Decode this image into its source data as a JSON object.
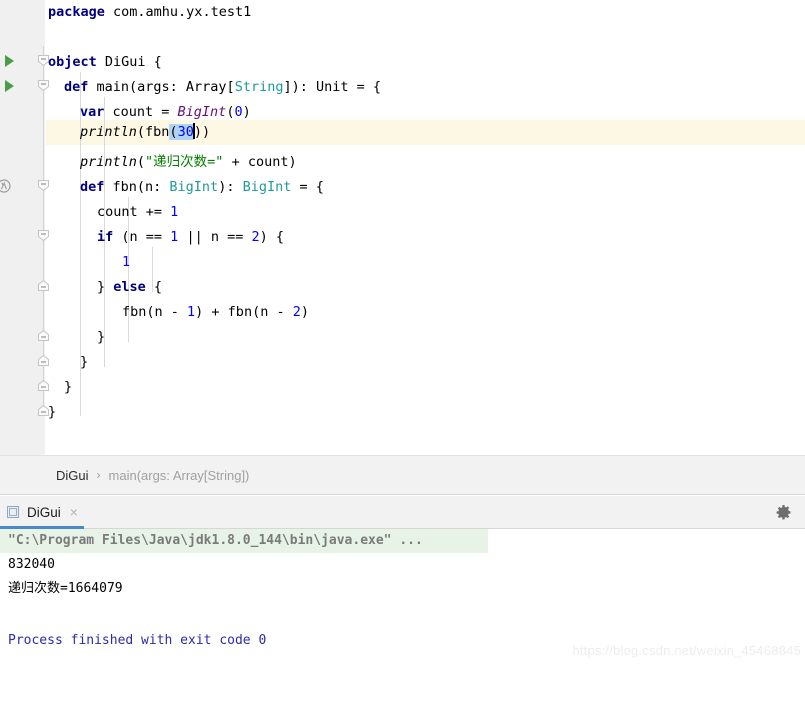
{
  "editor": {
    "name": "scala-code-editor",
    "language": "Scala",
    "current_line_number": 6,
    "colors": {
      "keyword": "#000080",
      "type": "#20999d",
      "number": "#0000ff",
      "string": "#008000",
      "class_name": "#660e7a",
      "selection": "#b0d3f5",
      "current_line": "#fdf8e3",
      "gutter": "#f0f0f0"
    },
    "lines": [
      {
        "n": 1,
        "tokens": [
          {
            "t": "package",
            "c": "kw"
          },
          {
            "t": " com.amhu.yx.test1",
            "c": "plain"
          }
        ]
      },
      {
        "n": 2,
        "tokens": []
      },
      {
        "n": 3,
        "tokens": [
          {
            "t": "object",
            "c": "kw"
          },
          {
            "t": " DiGui {",
            "c": "plain"
          }
        ]
      },
      {
        "n": 4,
        "tokens": [
          {
            "t": "def",
            "c": "kw"
          },
          {
            "t": " main(args: Array[",
            "c": "plain"
          },
          {
            "t": "String",
            "c": "typ"
          },
          {
            "t": "]): Unit = {",
            "c": "plain"
          }
        ]
      },
      {
        "n": 5,
        "tokens": [
          {
            "t": "var",
            "c": "kw"
          },
          {
            "t": " count = ",
            "c": "plain"
          },
          {
            "t": "BigInt",
            "c": "cls"
          },
          {
            "t": "(",
            "c": "plain"
          },
          {
            "t": "0",
            "c": "num"
          },
          {
            "t": ")",
            "c": "plain"
          }
        ]
      },
      {
        "n": 6,
        "tokens": [
          {
            "t": "println",
            "c": "fn"
          },
          {
            "t": "(fbn",
            "c": "plain"
          },
          {
            "t": "(",
            "c": "sel-plain"
          },
          {
            "t": "30",
            "c": "sel-num"
          },
          {
            "t": "))",
            "c": "plain"
          }
        ]
      },
      {
        "n": 7,
        "tokens": [
          {
            "t": "println",
            "c": "fn"
          },
          {
            "t": "(",
            "c": "plain"
          },
          {
            "t": "\"递归次数=\"",
            "c": "str"
          },
          {
            "t": " + count)",
            "c": "plain"
          }
        ]
      },
      {
        "n": 8,
        "tokens": [
          {
            "t": "def",
            "c": "kw"
          },
          {
            "t": " fbn(n: ",
            "c": "plain"
          },
          {
            "t": "BigInt",
            "c": "typ"
          },
          {
            "t": "): ",
            "c": "plain"
          },
          {
            "t": "BigInt",
            "c": "typ"
          },
          {
            "t": " = {",
            "c": "plain"
          }
        ]
      },
      {
        "n": 9,
        "tokens": [
          {
            "t": "count += ",
            "c": "plain"
          },
          {
            "t": "1",
            "c": "num"
          }
        ]
      },
      {
        "n": 10,
        "tokens": [
          {
            "t": "if",
            "c": "kw"
          },
          {
            "t": " (n == ",
            "c": "plain"
          },
          {
            "t": "1",
            "c": "num"
          },
          {
            "t": " || n == ",
            "c": "plain"
          },
          {
            "t": "2",
            "c": "num"
          },
          {
            "t": ") {",
            "c": "plain"
          }
        ]
      },
      {
        "n": 11,
        "tokens": [
          {
            "t": "1",
            "c": "num"
          }
        ]
      },
      {
        "n": 12,
        "tokens": [
          {
            "t": "} ",
            "c": "plain"
          },
          {
            "t": "else",
            "c": "kw"
          },
          {
            "t": " {",
            "c": "plain"
          }
        ]
      },
      {
        "n": 13,
        "tokens": [
          {
            "t": "fbn(n - ",
            "c": "plain"
          },
          {
            "t": "1",
            "c": "num"
          },
          {
            "t": ") + fbn(n - ",
            "c": "plain"
          },
          {
            "t": "2",
            "c": "num"
          },
          {
            "t": ")",
            "c": "plain"
          }
        ]
      },
      {
        "n": 14,
        "tokens": [
          {
            "t": "}",
            "c": "plain"
          }
        ]
      },
      {
        "n": 15,
        "tokens": [
          {
            "t": "}",
            "c": "plain"
          }
        ]
      },
      {
        "n": 16,
        "tokens": [
          {
            "t": "}",
            "c": "plain"
          }
        ]
      },
      {
        "n": 17,
        "tokens": [
          {
            "t": "}",
            "c": "plain"
          }
        ]
      }
    ],
    "gutter_icons": {
      "run_object": "run-arrow-icon",
      "run_main": "run-arrow-icon",
      "lambda": "lambda-icon",
      "fold_open": "fold-collapse-icon",
      "fold_close": "fold-expand-icon"
    }
  },
  "breadcrumb": {
    "root": "DiGui",
    "separator": "›",
    "leaf": "main(args: Array[String])"
  },
  "console": {
    "tab_label": "DiGui",
    "tab_close": "×",
    "tab_icon": "application-icon",
    "settings_icon": "gear-icon",
    "output": [
      {
        "text": "\"C:\\Program Files\\Java\\jdk1.8.0_144\\bin\\java.exe\" ...",
        "style": "cmd"
      },
      {
        "text": "832040",
        "style": "std"
      },
      {
        "text": "递归次数=1664079",
        "style": "std"
      },
      {
        "text": "",
        "style": "std"
      },
      {
        "text": "Process finished with exit code 0",
        "style": "exit"
      }
    ]
  },
  "watermark": {
    "text": "https://blog.csdn.net/weixin_45468845"
  }
}
